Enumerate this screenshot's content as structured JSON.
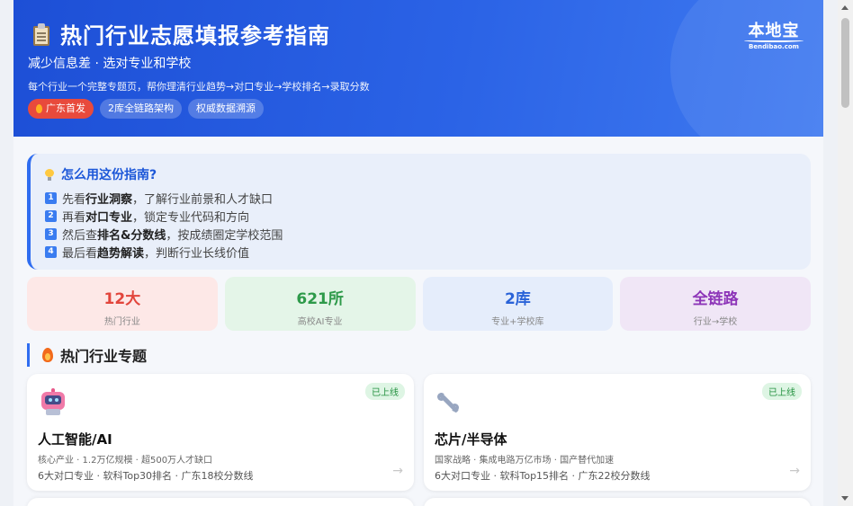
{
  "hero": {
    "title": "热门行业志愿填报参考指南",
    "subtitle": "减少信息差 · 选对专业和学校",
    "desc": "每个行业一个完整专题页，帮你理清行业趋势→对口专业→学校排名→录取分数",
    "badges": [
      "广东首发",
      "2库全链路架构",
      "权威数据溯源"
    ],
    "logo_cn": "本地宝",
    "logo_en": "Bendibao.com"
  },
  "guide": {
    "title": "怎么用这份指南?",
    "steps": [
      {
        "num": "1",
        "pre": "先看",
        "bold": "行业洞察",
        "post": "，了解行业前景和人才缺口"
      },
      {
        "num": "2",
        "pre": "再看",
        "bold": "对口专业",
        "post": "，锁定专业代码和方向"
      },
      {
        "num": "3",
        "pre": "然后查",
        "bold": "排名&分数线",
        "post": "，按成绩圈定学校范围"
      },
      {
        "num": "4",
        "pre": "最后看",
        "bold": "趋势解读",
        "post": "，判断行业长线价值"
      }
    ]
  },
  "stats": [
    {
      "value": "12大",
      "label": "热门行业",
      "color": "#e2453c",
      "bg": "#fde8e7"
    },
    {
      "value": "621所",
      "label": "高校AI专业",
      "color": "#2e9a4a",
      "bg": "#e4f5e8"
    },
    {
      "value": "2库",
      "label": "专业+学校库",
      "color": "#2a63d8",
      "bg": "#e5edfb"
    },
    {
      "value": "全链路",
      "label": "行业→学校",
      "color": "#8d35b8",
      "bg": "#f0e6f6"
    }
  ],
  "section": {
    "title": "热门行业专题"
  },
  "cards": [
    {
      "title": "人工智能/AI",
      "status": "已上线",
      "meta1": "核心产业 · 1.2万亿规模 · 超500万人才缺口",
      "meta2": "6大对口专业 · 软科Top30排名 · 广东18校分数线",
      "icon": "robot-icon"
    },
    {
      "title": "芯片/半导体",
      "status": "已上线",
      "meta1": "国家战略 · 集成电路万亿市场 · 国产替代加速",
      "meta2": "6大对口专业 · 软科Top15排名 · 广东22校分数线",
      "icon": "wrench-icon"
    }
  ],
  "arrow": "→"
}
